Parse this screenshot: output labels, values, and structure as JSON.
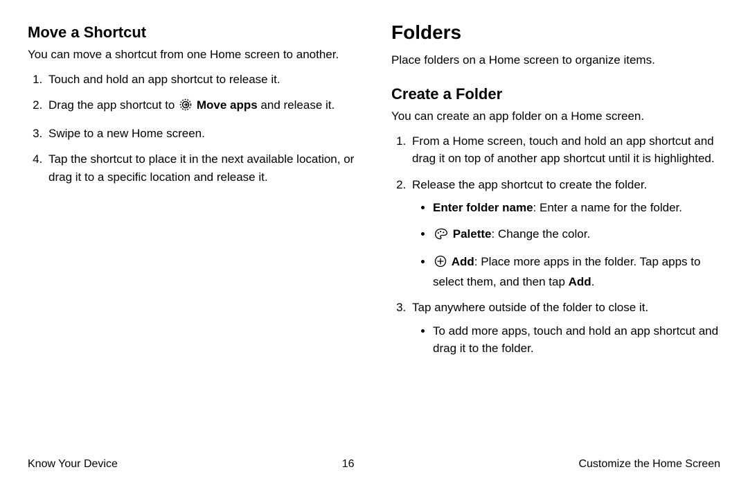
{
  "left": {
    "h2": "Move a Shortcut",
    "intro": "You can move a shortcut from one Home screen to another.",
    "step1": "Touch and hold an app shortcut to release it.",
    "step2_pre": "Drag the app shortcut to ",
    "step2_bold": "Move apps",
    "step2_post": " and release it.",
    "step3": "Swipe to a new Home screen.",
    "step4": "Tap the shortcut to place it in the next available location, or drag it to a specific location and release it."
  },
  "right": {
    "h1": "Folders",
    "intro": "Place folders on a Home screen to organize items.",
    "h2": "Create a Folder",
    "sub_intro": "You can create an app folder on a Home screen.",
    "step1": "From a Home screen, touch and hold an app shortcut and drag it on top of another app shortcut until it is highlighted.",
    "step2": "Release the app shortcut to create the folder.",
    "b1_bold": "Enter folder name",
    "b1_rest": ": Enter a name for the folder.",
    "b2_bold": "Palette",
    "b2_rest": ": Change the color.",
    "b3_bold": "Add",
    "b3_rest_a": ": Place more apps in the folder. Tap apps to select them, and then tap ",
    "b3_rest_b": "Add",
    "b3_rest_c": ".",
    "step3": "Tap anywhere outside of the folder to close it.",
    "b4": "To add more apps, touch and hold an app shortcut and drag it to the folder."
  },
  "footer": {
    "left": "Know Your Device",
    "center": "16",
    "right": "Customize the Home Screen"
  }
}
